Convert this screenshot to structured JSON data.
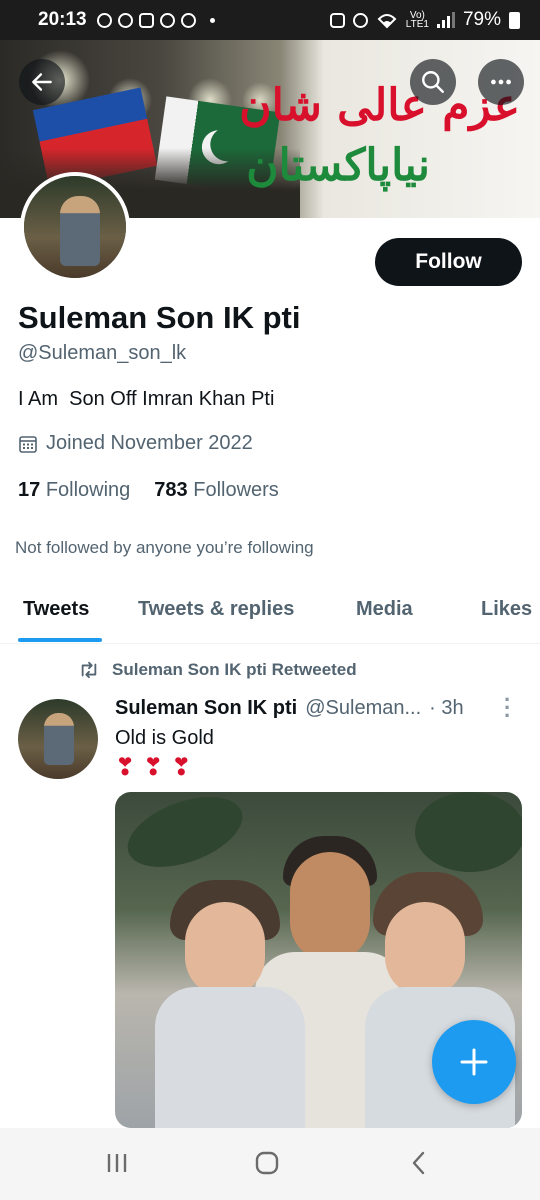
{
  "status_bar": {
    "time": "20:13",
    "battery": "79%",
    "volte": "Vo)",
    "lte": "LTE1"
  },
  "banner": {
    "urdu_line_1": "عزم عالی شان",
    "urdu_line_2": "نیاپاکستان"
  },
  "profile": {
    "follow_label": "Follow",
    "name": "Suleman Son IK pti",
    "handle": "@Suleman_son_lk",
    "bio": "I Am  Son Off Imran Khan Pti",
    "joined": "Joined November 2022",
    "following_count": "17",
    "following_label": "Following",
    "followers_count": "783",
    "followers_label": "Followers",
    "not_followed": "Not followed by anyone you’re following"
  },
  "tabs": [
    {
      "label": "Tweets",
      "active": true
    },
    {
      "label": "Tweets & replies",
      "active": false
    },
    {
      "label": "Media",
      "active": false
    },
    {
      "label": "Likes",
      "active": false
    }
  ],
  "tweet": {
    "retweet_label": "Suleman Son IK pti Retweeted",
    "author_name": "Suleman Son IK pti",
    "author_handle": "@Suleman...",
    "time": "· 3h",
    "text": "Old is Gold",
    "emojis": "❣❣❣"
  },
  "icons": {
    "back": "arrow-left-icon",
    "search": "search-icon",
    "more": "more-icon",
    "calendar": "calendar-icon",
    "retweet": "retweet-icon",
    "compose": "plus-icon"
  },
  "colors": {
    "accent": "#1d9bf0",
    "text": "#0f1419",
    "muted": "#536471",
    "urdu_red": "#d8102c",
    "urdu_green": "#1e8a3c"
  }
}
